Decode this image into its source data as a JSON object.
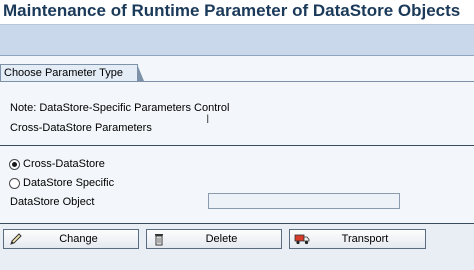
{
  "window": {
    "title": "Maintenance of Runtime Parameter of DataStore Objects"
  },
  "tabs": [
    {
      "label": "Choose Parameter Type",
      "selected": true
    }
  ],
  "notes": [
    "Note: DataStore-Specific Parameters Control",
    "Cross-DataStore Parameters"
  ],
  "parameter_type": {
    "options": [
      {
        "label": "Cross-DataStore",
        "selected": true
      },
      {
        "label": "DataStore Specific",
        "selected": false
      }
    ]
  },
  "datastore_object": {
    "label": "DataStore Object",
    "value": "",
    "placeholder": ""
  },
  "buttons": {
    "change": {
      "label": "Change",
      "icon": "pencil-icon"
    },
    "delete": {
      "label": "Delete",
      "icon": "trash-icon"
    },
    "transport": {
      "label": "Transport",
      "icon": "truck-icon"
    }
  },
  "colors": {
    "title_text": "#1b3a5a",
    "toolbar": "#c9d8ea",
    "background": "#f3f6fa"
  }
}
